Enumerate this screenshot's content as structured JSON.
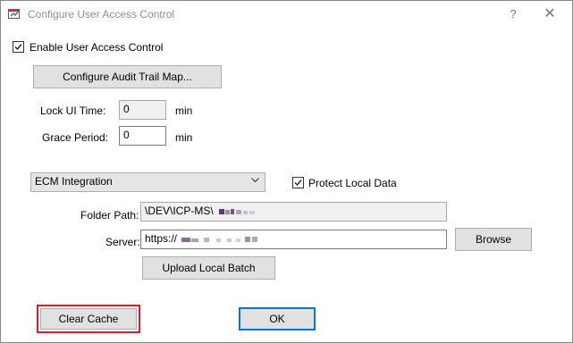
{
  "window": {
    "title": "Configure User Access Control",
    "help_glyph": "?",
    "close_glyph": "✕"
  },
  "enable_uac": {
    "label": "Enable User Access Control",
    "checked": true
  },
  "audit_button": {
    "label": "Configure Audit Trail Map..."
  },
  "lock_ui": {
    "label": "Lock UI Time:",
    "value": "0",
    "unit": "min"
  },
  "grace_period": {
    "label": "Grace Period:",
    "value": "0",
    "unit": "min"
  },
  "integration": {
    "selected": "ECM Integration"
  },
  "protect_local": {
    "label": "Protect Local Data",
    "checked": true
  },
  "folder_path": {
    "label": "Folder Path:",
    "value": "\\DEV\\ICP-MS\\"
  },
  "server": {
    "label": "Server:",
    "value": "https://"
  },
  "browse_button": {
    "label": "Browse"
  },
  "upload_button": {
    "label": "Upload Local Batch"
  },
  "clear_cache_button": {
    "label": "Clear Cache"
  },
  "ok_button": {
    "label": "OK"
  },
  "colors": {
    "highlight": "#e8182b",
    "default_button_border": "#0078d7"
  }
}
